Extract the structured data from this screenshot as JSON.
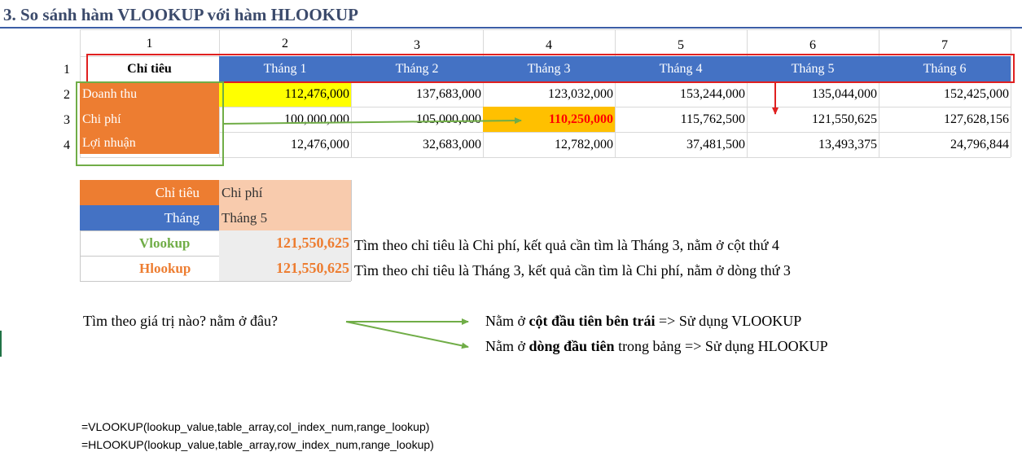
{
  "title": "3. So sánh hàm VLOOKUP với hàm HLOOKUP",
  "col_numbers": [
    "1",
    "2",
    "3",
    "4",
    "5",
    "6",
    "7"
  ],
  "row_numbers": [
    "1",
    "2",
    "3",
    "4"
  ],
  "table": {
    "header_label": "Chỉ tiêu",
    "months": [
      "Tháng 1",
      "Tháng 2",
      "Tháng 3",
      "Tháng 4",
      "Tháng 5",
      "Tháng 6"
    ],
    "rows": [
      {
        "label": "Doanh thu",
        "values": [
          "112,476,000",
          "137,683,000",
          "123,032,000",
          "153,244,000",
          "135,044,000",
          "152,425,000"
        ]
      },
      {
        "label": "Chi phí",
        "values": [
          "100,000,000",
          "105,000,000",
          "110,250,000",
          "115,762,500",
          "121,550,625",
          "127,628,156"
        ]
      },
      {
        "label": "Lợi nhuận",
        "values": [
          "12,476,000",
          "32,683,000",
          "12,782,000",
          "37,481,500",
          "13,493,375",
          "24,796,844"
        ]
      }
    ]
  },
  "lookup": {
    "criteria_label": "Chỉ tiêu",
    "criteria_value": "Chi phí",
    "month_label": "Tháng",
    "month_value": "Tháng 5",
    "vlookup_label": "Vlookup",
    "vlookup_result": "121,550,625",
    "vlookup_note": "Tìm theo chỉ tiêu là Chi phí, kết quả cần tìm là Tháng 3, nằm ở cột thứ 4",
    "hlookup_label": "Hlookup",
    "hlookup_result": "121,550,625",
    "hlookup_note": "Tìm theo chỉ tiêu là Tháng 3, kết quả cần tìm là Chi phí, nằm ở dòng thứ 3"
  },
  "guide": {
    "question": "Tìm theo giá trị nào? nằm ở đâu?",
    "line1_a": "Nằm ở ",
    "line1_b": "cột đầu tiên bên trái",
    "line1_c": " => Sử dụng VLOOKUP",
    "line2_a": "Nằm ở ",
    "line2_b": "dòng đầu tiên",
    "line2_c": " trong bảng => Sử dụng HLOOKUP"
  },
  "formulas": {
    "vlookup": "=VLOOKUP(lookup_value,table_array,col_index_num,range_lookup)",
    "hlookup": "=HLOOKUP(lookup_value,table_array,row_index_num,range_lookup)"
  },
  "colors": {
    "header_blue": "#4472c4",
    "orange": "#ed7d31",
    "peach": "#f8cbad",
    "highlight_yellow": "#ffff00",
    "highlight_gold": "#ffc000",
    "result_orange": "#ed7d31",
    "vlookup_green": "#70ad47",
    "red_box": "#e02020",
    "green_box": "#70ad47"
  }
}
